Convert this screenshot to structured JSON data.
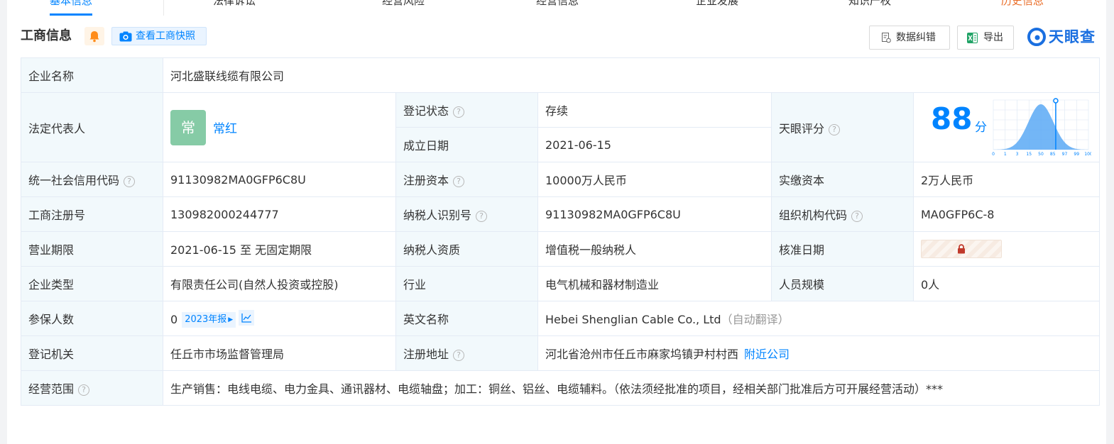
{
  "tabs": [
    "基本信息",
    "法律诉讼",
    "经营风险",
    "经营信息",
    "企业发展",
    "知识产权",
    "历史信息"
  ],
  "header": {
    "title": "工商信息",
    "snapshot_label": "查看工商快照",
    "correct_label": "数据纠错",
    "export_label": "导出",
    "logo_text": "天眼查"
  },
  "icons": {
    "bell": "bell-icon",
    "camera": "camera-icon",
    "correct": "document-edit-icon",
    "export": "excel-icon",
    "logo": "tianyancha-logo",
    "help": "question-circle-icon",
    "lock": "lock-icon",
    "trend": "trend-chart-icon"
  },
  "colors": {
    "accent": "#0084ff",
    "status_green": "#2da44e",
    "label_bg": "#f2f9fc",
    "avatar_bg": "#86cba6"
  },
  "info": {
    "company_name_label": "企业名称",
    "company_name": "河北盛联线缆有限公司",
    "legal_rep_label": "法定代表人",
    "legal_rep_avatar": "常",
    "legal_rep_name": "常红",
    "reg_status_label": "登记状态",
    "reg_status": "存续",
    "founded_label": "成立日期",
    "founded": "2021-06-15",
    "score_label": "天眼评分",
    "score": "88",
    "score_unit": "分",
    "credit_code_label": "统一社会信用代码",
    "credit_code": "91130982MA0GFP6C8U",
    "reg_capital_label": "注册资本",
    "reg_capital": "10000万人民币",
    "paid_capital_label": "实缴资本",
    "paid_capital": "2万人民币",
    "biz_reg_no_label": "工商注册号",
    "biz_reg_no": "130982000244777",
    "taxpayer_id_label": "纳税人识别号",
    "taxpayer_id": "91130982MA0GFP6C8U",
    "org_code_label": "组织机构代码",
    "org_code": "MA0GFP6C-8",
    "term_label": "营业期限",
    "term": "2021-06-15 至 无固定期限",
    "taxpayer_qual_label": "纳税人资质",
    "taxpayer_qual": "增值税一般纳税人",
    "approval_date_label": "核准日期",
    "company_type_label": "企业类型",
    "company_type": "有限责任公司(自然人投资或控股)",
    "industry_label": "行业",
    "industry": "电气机械和器材制造业",
    "staff_size_label": "人员规模",
    "staff_size": "0人",
    "insured_label": "参保人数",
    "insured": "0",
    "insured_report": "2023年报",
    "english_name_label": "英文名称",
    "english_name": "Hebei Shenglian Cable Co., Ltd",
    "english_name_note": "（自动翻译）",
    "reg_authority_label": "登记机关",
    "reg_authority": "任丘市市场监督管理局",
    "reg_address_label": "注册地址",
    "reg_address": "河北省沧州市任丘市麻家坞镇尹村村西",
    "nearby_label": "附近公司",
    "scope_label": "经营范围",
    "scope": "生产销售：电线电缆、电力金具、通讯器材、电缆轴盘；加工：铜丝、铝丝、电缆辅料。（依法须经批准的项目，经相关部门批准后方可开展经营活动）***"
  },
  "chart_data": {
    "type": "area",
    "x_ticks": [
      "0",
      "1",
      "3",
      "15",
      "50",
      "85",
      "97",
      "99",
      "100"
    ],
    "marker": 88,
    "title": "",
    "xlabel": "",
    "ylabel": ""
  }
}
